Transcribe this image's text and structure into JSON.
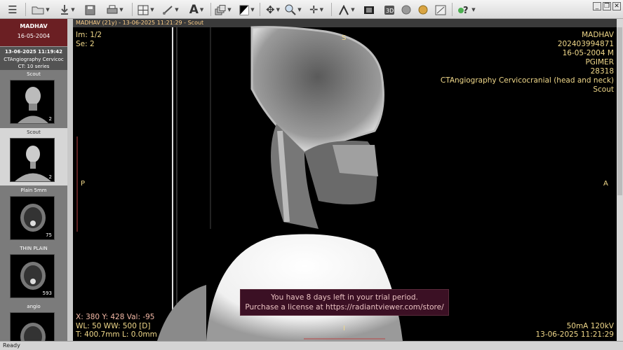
{
  "toolbar": {
    "tools": [
      "menu-icon",
      "open-folder-icon",
      "download-icon",
      "save-icon",
      "print-icon",
      "layout-grid-icon",
      "measure-icon",
      "text-annotation-icon",
      "stack-icon",
      "window-level-icon",
      "pan-icon",
      "zoom-icon",
      "crosshair-icon",
      "angle-icon",
      "film-icon",
      "3d-icon",
      "rotate-icon",
      "fusion-icon",
      "help-icon"
    ],
    "window_controls": [
      "minimize",
      "restore",
      "close"
    ]
  },
  "patient": {
    "name": "MADHAV",
    "dob": "16-05-2004"
  },
  "study": {
    "datetime": "13-06-2025 11:19:42",
    "description": "CTAngiography Cervicoc",
    "series_count": "CT: 10 series"
  },
  "series": [
    {
      "label": "Scout",
      "count": "2",
      "selected": false
    },
    {
      "label": "Scout",
      "count": "2",
      "selected": true
    },
    {
      "label": "Plain 5mm",
      "count": "75",
      "selected": false
    },
    {
      "label": "THIN PLAIN",
      "count": "593",
      "selected": false
    },
    {
      "label": "angio",
      "count": "",
      "selected": false
    }
  ],
  "viewer": {
    "title": "MADHAV  (21y) - 13-06-2025 11:21:29 - Scout",
    "top_left": {
      "image": "Im: 1/2",
      "series": "Se: 2"
    },
    "top_right": [
      "MADHAV",
      "202403994871",
      "16-05-2004 M",
      "PGIMER",
      "28318",
      "CTAngiography Cervicocranial (head and neck)",
      "Scout"
    ],
    "orientation": {
      "top": "S",
      "left": "P",
      "right": "A",
      "bottom": "I"
    },
    "bottom_left": [
      "X: 380 Y: 428 Val: -95",
      "WL: 50 WW: 500 [D]",
      "T: 400.7mm L: 0.0mm"
    ],
    "bottom_right": [
      "50mA 120kV",
      "13-06-2025 11:21:29"
    ],
    "trial": [
      "You have 8 days left in your trial period.",
      "Purchase a license at https://radiantviewer.com/store/"
    ]
  },
  "status": "Ready"
}
